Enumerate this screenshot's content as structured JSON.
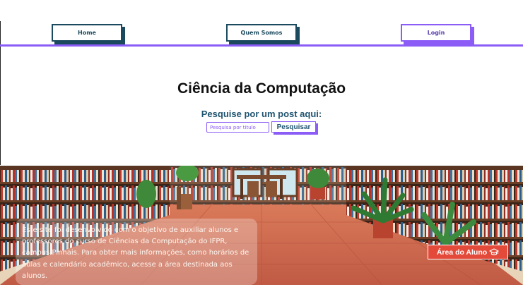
{
  "nav": {
    "home_label": "Home",
    "about_label": "Quem Somos",
    "login_label": "Login"
  },
  "main": {
    "title": "Ciência da Computação",
    "search_label": "Pesquise por um post aqui:",
    "search_placeholder": "Pesquisa por titulo",
    "search_button": "Pesquisar"
  },
  "banner": {
    "description": "Este site foi desenvolvido com o objetivo de auxiliar alunos e professores do curso de Ciências da Computação do IFPR, campus Pinhais. Para obter mais informações, como horários de aulas e calendário acadêmico, acesse a área destinada aos alunos.",
    "student_area_button": "Área do Aluno",
    "student_area_icon": "graduation-cap-icon"
  },
  "colors": {
    "accent": "#8b5cf6",
    "navy": "#1b4a5e",
    "button_red": "#e34a3a"
  }
}
